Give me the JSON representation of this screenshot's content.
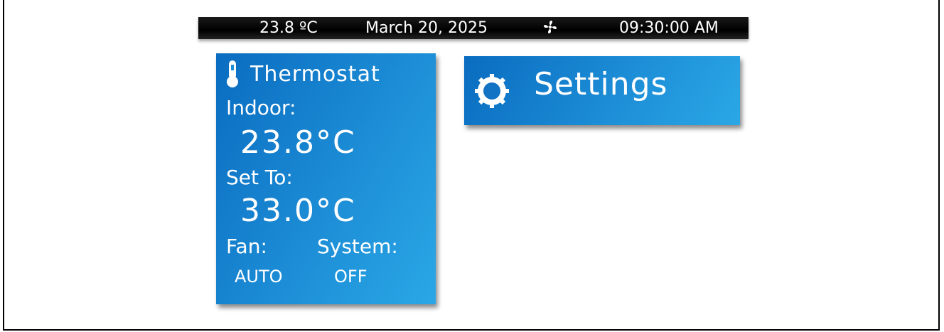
{
  "status_bar": {
    "temperature": "23.8 ºC",
    "date": "March 20, 2025",
    "fan_icon": "fan-icon",
    "time": "09:30:00 AM"
  },
  "thermostat": {
    "icon": "thermometer-icon",
    "title": "Thermostat",
    "indoor_label": "Indoor:",
    "indoor_value": "23.8°C",
    "setto_label": "Set To:",
    "setto_value": "33.0°C",
    "fan_label": "Fan:",
    "fan_value": "AUTO",
    "system_label": "System:",
    "system_value": "OFF"
  },
  "settings": {
    "icon": "gear-icon",
    "label": "Settings"
  },
  "colors": {
    "tile_start": "#0a6cc0",
    "tile_end": "#2aa7e6",
    "status_bar": "#000000"
  }
}
